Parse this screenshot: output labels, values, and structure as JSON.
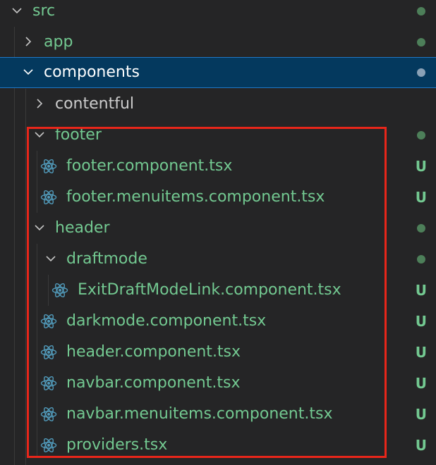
{
  "explorer": {
    "folders": {
      "src": {
        "label": "src"
      },
      "app": {
        "label": "app"
      },
      "components": {
        "label": "components"
      },
      "contentful": {
        "label": "contentful"
      },
      "footer": {
        "label": "footer"
      },
      "header": {
        "label": "header"
      },
      "draftmode": {
        "label": "draftmode"
      }
    },
    "files": {
      "footer_component": {
        "label": "footer.component.tsx",
        "status": "U"
      },
      "footer_menuitems": {
        "label": "footer.menuitems.component.tsx",
        "status": "U"
      },
      "exit_draft": {
        "label": "ExitDraftModeLink.component.tsx",
        "status": "U"
      },
      "darkmode": {
        "label": "darkmode.component.tsx",
        "status": "U"
      },
      "header_component": {
        "label": "header.component.tsx",
        "status": "U"
      },
      "navbar_component": {
        "label": "navbar.component.tsx",
        "status": "U"
      },
      "navbar_menuitems": {
        "label": "navbar.menuitems.component.tsx",
        "status": "U"
      },
      "providers": {
        "label": "providers.tsx",
        "status": "U"
      }
    }
  },
  "colors": {
    "background": "#252526",
    "selected_row": "#04395e",
    "untracked_text": "#73c991",
    "highlight_border": "#e8261a",
    "react_icon": "#519aba"
  }
}
